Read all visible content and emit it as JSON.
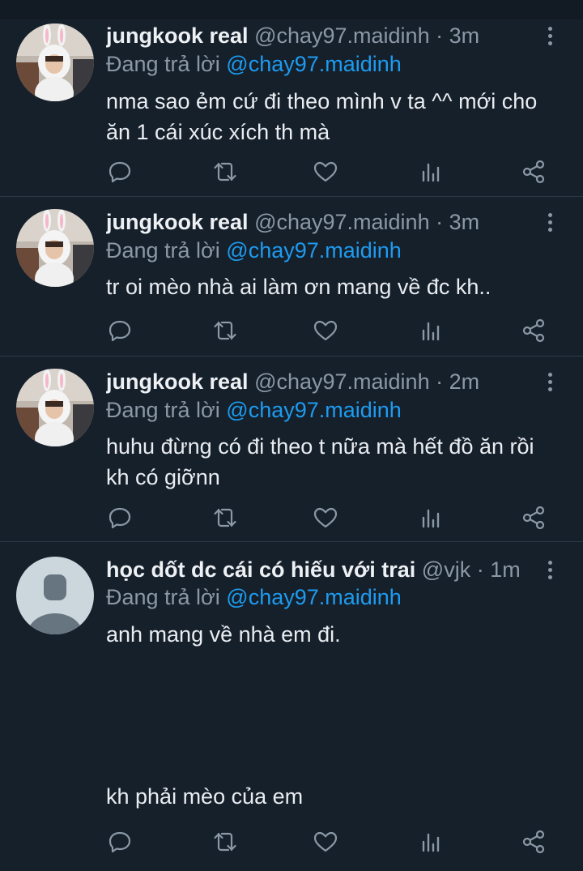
{
  "tweets": [
    {
      "name": "jungkook real",
      "handle": "@chay97.maidinh",
      "separator": "·",
      "time": "3m",
      "reply_prefix": "Đang trả lời",
      "reply_mention": "@chay97.maidinh",
      "text_lines": [
        "nma sao ẻm cứ đi theo mình v ta ^^ mới cho",
        "ăn 1 cái xúc xích th mà"
      ],
      "avatar": "bunny-costume-photo"
    },
    {
      "name": "jungkook real",
      "handle": "@chay97.maidinh",
      "separator": "·",
      "time": "3m",
      "reply_prefix": "Đang trả lời",
      "reply_mention": "@chay97.maidinh",
      "text_lines": [
        "tr oi mèo nhà ai làm ơn mang về đc kh.."
      ],
      "avatar": "bunny-costume-photo"
    },
    {
      "name": "jungkook real",
      "handle": "@chay97.maidinh",
      "separator": "·",
      "time": "2m",
      "reply_prefix": "Đang trả lời",
      "reply_mention": "@chay97.maidinh",
      "text_lines": [
        "huhu đừng có đi theo t nữa mà hết đồ ăn rồi",
        "kh có giỡnn"
      ],
      "avatar": "bunny-costume-photo"
    },
    {
      "name": "học dốt dc cái có hiếu với trai",
      "handle": "@vjk",
      "separator": "·",
      "time": "1m",
      "reply_prefix": "Đang trả lời",
      "reply_mention": "@chay97.maidinh",
      "text_lines": [
        "anh mang về nhà em đi.",
        "kh phải mèo của em"
      ],
      "avatar": "default-profile"
    }
  ],
  "icons": {
    "reply": "reply-icon",
    "retweet": "retweet-icon",
    "like": "like-icon",
    "views": "views-icon",
    "share": "share-icon",
    "more": "more-icon"
  },
  "colors": {
    "background": "#16202b",
    "divider": "#2c3945",
    "secondary_text": "#8b98a5",
    "mention": "#1d9bf0",
    "primary_text": "#e9edf1"
  }
}
